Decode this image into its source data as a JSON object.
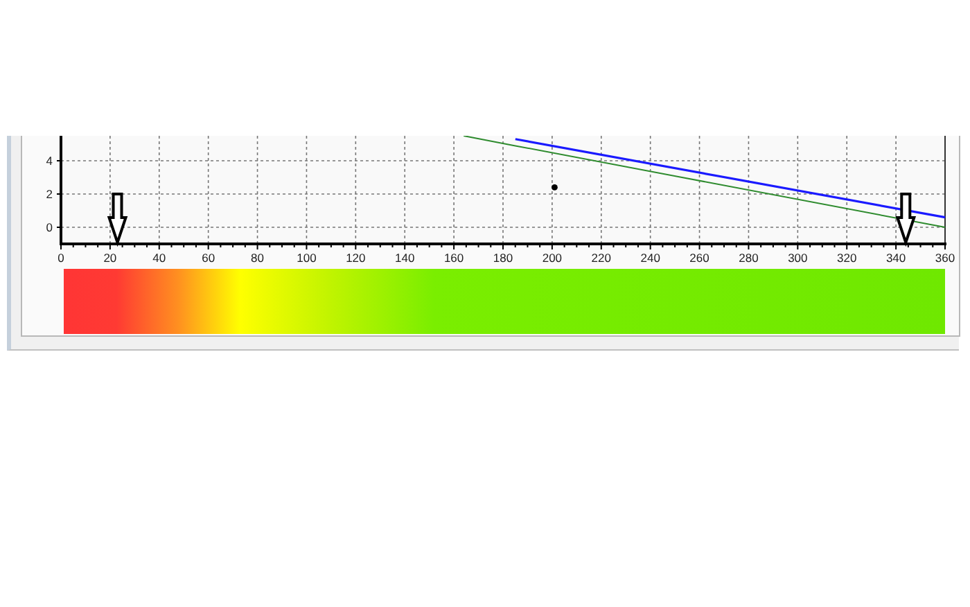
{
  "plot_panel": {
    "chart_data": {
      "type": "line",
      "x": [
        164,
        185,
        360
      ],
      "series": [
        {
          "color": "#2e8b2e",
          "values": [
            5.5,
            4.9,
            0
          ]
        },
        {
          "color": "#1a1aff",
          "values": [
            null,
            5.3,
            0.6
          ]
        }
      ],
      "xlim": [
        0,
        360
      ],
      "ylim": [
        -1,
        5.5
      ],
      "xticks": [
        0,
        20,
        40,
        60,
        80,
        100,
        120,
        140,
        160,
        180,
        200,
        220,
        240,
        260,
        280,
        300,
        320,
        340,
        360
      ],
      "yticks": [
        0,
        2,
        4
      ],
      "grid": true
    },
    "markers": [
      {
        "kind": "arrow"
      },
      {
        "kind": "arrow"
      },
      {
        "kind": "dot"
      }
    ]
  }
}
